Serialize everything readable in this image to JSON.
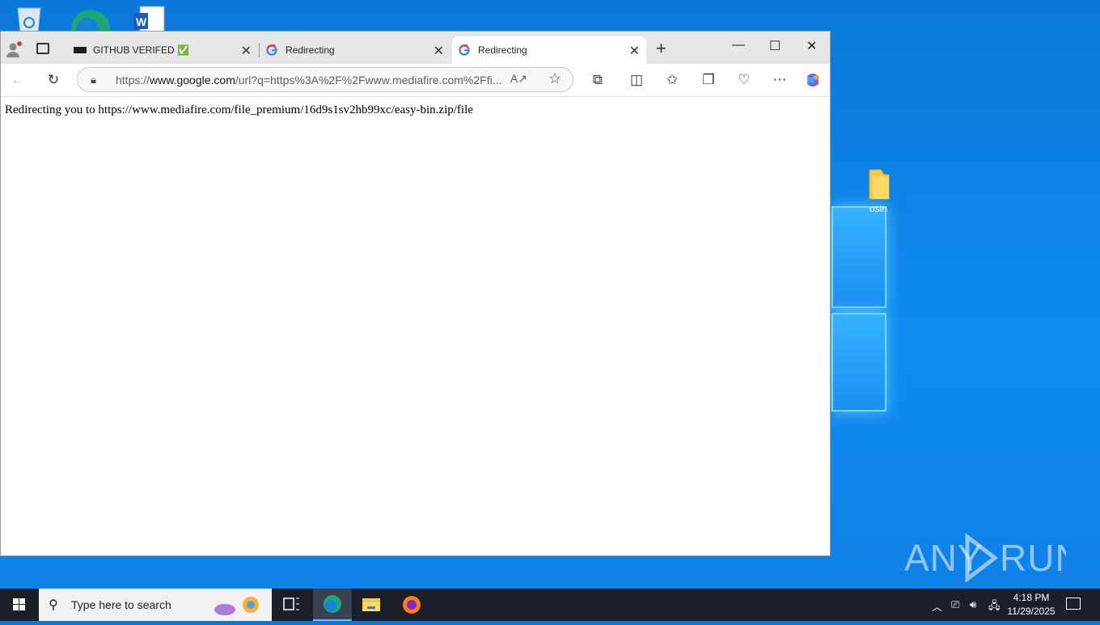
{
  "desktop": {
    "folder_label": "osin",
    "watermark": "ANY RUN"
  },
  "browser": {
    "tabs": [
      {
        "title": "GITHUB VERIFED ✅",
        "favicon": "dark-banner-icon",
        "active": false
      },
      {
        "title": "Redirecting",
        "favicon": "google-icon",
        "active": false
      },
      {
        "title": "Redirecting",
        "favicon": "google-icon",
        "active": true
      }
    ],
    "address": {
      "url_prefix": "https://",
      "url_domain": "www.google.com",
      "url_rest": "/url?q=https%3A%2F%2Fwww.mediafire.com%2Ffi..."
    },
    "page": {
      "text": "Redirecting you to https://www.mediafire.com/file_premium/16d9s1sv2hb99xc/easy-bin.zip/file"
    }
  },
  "taskbar": {
    "search_placeholder": "Type here to search",
    "time": "4:18 PM",
    "date": "11/29/2025"
  },
  "colors": {
    "desktop_blue": "#0f8cf0",
    "taskbar": "#1b1f2a",
    "tabstrip": "#e6e6e6"
  }
}
